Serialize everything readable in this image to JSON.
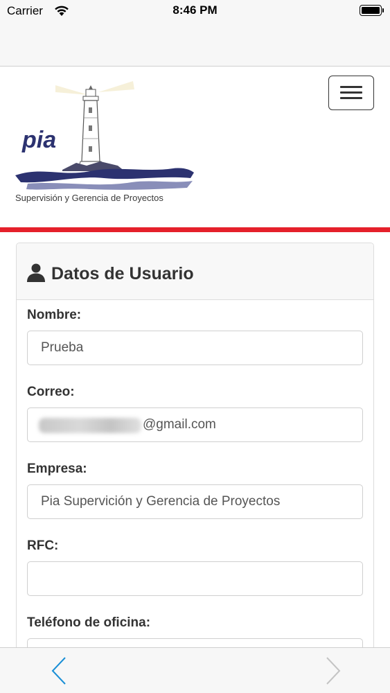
{
  "status_bar": {
    "carrier": "Carrier",
    "time": "8:46 PM"
  },
  "header": {
    "logo_text": "pia",
    "logo_caption": "Supervisión y Gerencia de Proyectos",
    "menu_icon": "hamburger-icon",
    "accent_color": "#e5202b"
  },
  "panel": {
    "title": "Datos de Usuario",
    "title_icon": "user-icon"
  },
  "form": {
    "nombre_label": "Nombre:",
    "nombre_value": "Prueba",
    "correo_label": "Correo:",
    "correo_value": "@gmail.com",
    "empresa_label": "Empresa:",
    "empresa_value": "Pia Supervición y Gerencia de Proyectos",
    "rfc_label": "RFC:",
    "rfc_value": "",
    "telefono_label": "Teléfono de oficina:",
    "telefono_value": ""
  },
  "toolbar": {
    "back_icon": "chevron-left-icon",
    "forward_icon": "chevron-right-icon",
    "back_color": "#1a8fd6",
    "forward_color": "#c4c4c4"
  }
}
